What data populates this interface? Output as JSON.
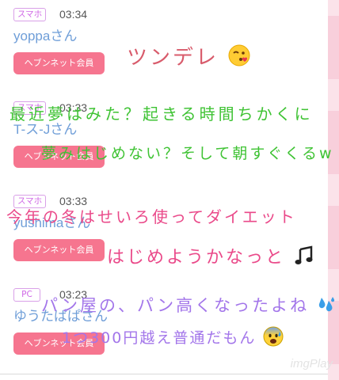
{
  "posts": [
    {
      "device": "スマホ",
      "time": "03:34",
      "user": "yoppaさん",
      "badge": "ヘブンネット会員"
    },
    {
      "device": "スマホ",
      "time": "03:33",
      "user": "T-ス-Jさん",
      "badge": "ヘブンネット会員"
    },
    {
      "device": "スマホ",
      "time": "03:33",
      "user": "yushimaさん",
      "badge": "ヘブンネット会員"
    },
    {
      "device": "PC",
      "time": "03:23",
      "user": "ゆうたぱぱさん",
      "badge": "ヘブンネット会員"
    }
  ],
  "overlay": {
    "line1": "ツンデレ",
    "line2": "最近夢はみた？起きる時間ちかくに",
    "line3": "夢みはじめない？そして朝すぐくるw",
    "line4": "今年の冬はせいろ使ってダイエット",
    "line5": "はじめようかなっと",
    "line6": "パン屋の、パン高くなったよね",
    "line7": "1つ300円越え普通だもん"
  },
  "icons": {
    "line1": "kissing-face-emoji",
    "line5": "music-notes-emoji",
    "line6": "sweat-droplets-emoji",
    "line7": "anxious-face-emoji"
  },
  "colors": {
    "tag_border": "#d9a0e8",
    "tag_text": "#cf67e6",
    "user_text": "#6f9ed8",
    "member_button": "#f6758f",
    "overlay_rose": "#d85b6b",
    "overlay_green": "#3fc334",
    "overlay_pink": "#ea4a8a",
    "overlay_purple": "#a376ea"
  },
  "watermark": "imgPlay"
}
